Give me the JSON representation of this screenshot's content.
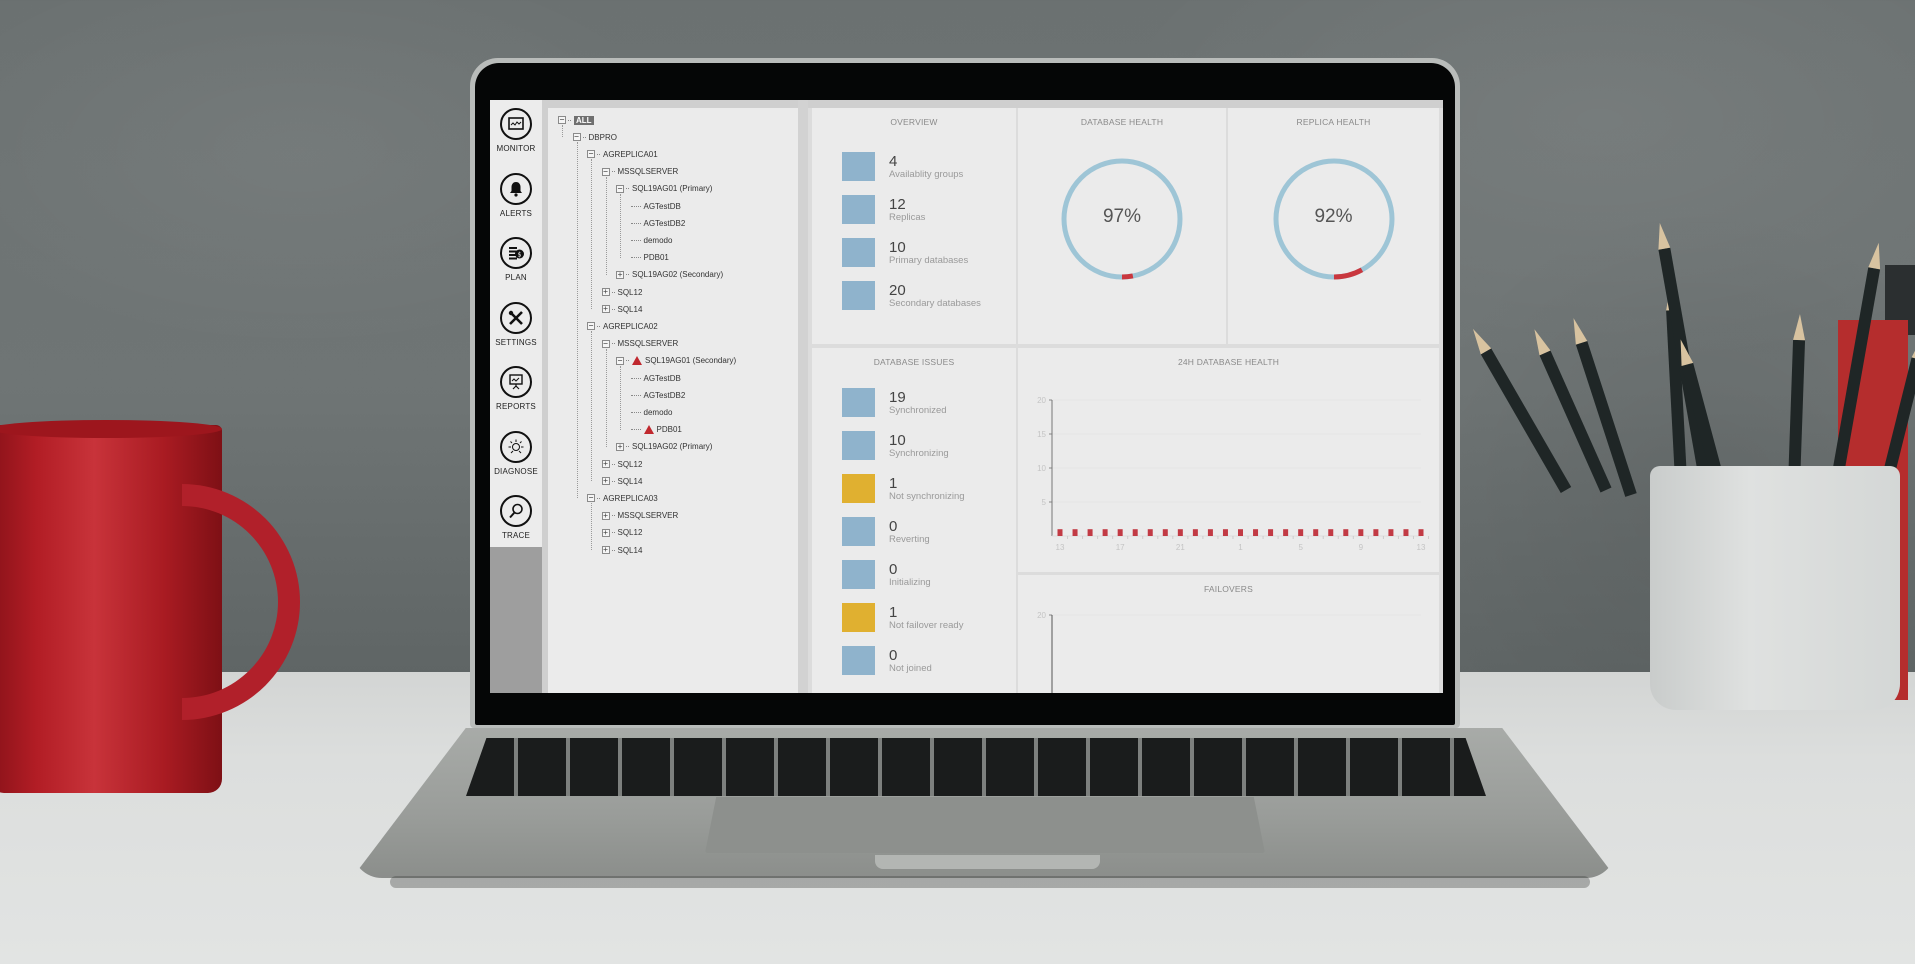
{
  "sidebar": {
    "items": [
      {
        "label": "MONITOR",
        "icon": "monitor-icon"
      },
      {
        "label": "ALERTS",
        "icon": "bell-icon"
      },
      {
        "label": "PLAN",
        "icon": "plan-icon"
      },
      {
        "label": "SETTINGS",
        "icon": "settings-icon"
      },
      {
        "label": "REPORTS",
        "icon": "reports-icon"
      },
      {
        "label": "DIAGNOSE",
        "icon": "lightbulb-icon"
      },
      {
        "label": "TRACE",
        "icon": "magnifier-icon"
      }
    ]
  },
  "tree": {
    "nodes": [
      {
        "label": "ALL",
        "level": 0,
        "expander": "minus",
        "selected": true
      },
      {
        "label": "DBPRO",
        "level": 1,
        "expander": "minus"
      },
      {
        "label": "AGREPLICA01",
        "level": 2,
        "expander": "minus"
      },
      {
        "label": "MSSQLSERVER",
        "level": 3,
        "expander": "minus"
      },
      {
        "label": "SQL19AG01 (Primary)",
        "level": 4,
        "expander": "minus"
      },
      {
        "label": "AGTestDB",
        "level": 5,
        "expander": "leaf"
      },
      {
        "label": "AGTestDB2",
        "level": 5,
        "expander": "leaf"
      },
      {
        "label": "demodo",
        "level": 5,
        "expander": "leaf"
      },
      {
        "label": "PDB01",
        "level": 5,
        "expander": "leaf"
      },
      {
        "label": "SQL19AG02 (Secondary)",
        "level": 4,
        "expander": "plus"
      },
      {
        "label": "SQL12",
        "level": 3,
        "expander": "plus"
      },
      {
        "label": "SQL14",
        "level": 3,
        "expander": "plus"
      },
      {
        "label": "AGREPLICA02",
        "level": 2,
        "expander": "minus"
      },
      {
        "label": "MSSQLSERVER",
        "level": 3,
        "expander": "minus"
      },
      {
        "label": "SQL19AG01 (Secondary)",
        "level": 4,
        "expander": "minus",
        "warning": true
      },
      {
        "label": "AGTestDB",
        "level": 5,
        "expander": "leaf"
      },
      {
        "label": "AGTestDB2",
        "level": 5,
        "expander": "leaf"
      },
      {
        "label": "demodo",
        "level": 5,
        "expander": "leaf"
      },
      {
        "label": "PDB01",
        "level": 5,
        "expander": "leaf",
        "warning": true
      },
      {
        "label": "SQL19AG02 (Primary)",
        "level": 4,
        "expander": "plus"
      },
      {
        "label": "SQL12",
        "level": 3,
        "expander": "plus"
      },
      {
        "label": "SQL14",
        "level": 3,
        "expander": "plus"
      },
      {
        "label": "AGREPLICA03",
        "level": 2,
        "expander": "minus"
      },
      {
        "label": "MSSQLSERVER",
        "level": 3,
        "expander": "plus"
      },
      {
        "label": "SQL12",
        "level": 3,
        "expander": "plus"
      },
      {
        "label": "SQL14",
        "level": 3,
        "expander": "plus"
      }
    ]
  },
  "overview": {
    "title": "OVERVIEW",
    "stats": [
      {
        "value": "4",
        "label": "Availablity groups",
        "status": "ok"
      },
      {
        "value": "12",
        "label": "Replicas",
        "status": "ok"
      },
      {
        "value": "10",
        "label": "Primary databases",
        "status": "ok"
      },
      {
        "value": "20",
        "label": "Secondary databases",
        "status": "ok"
      }
    ]
  },
  "database_health": {
    "title": "DATABASE HEALTH",
    "value_text": "97%",
    "healthy_fraction": 0.97
  },
  "replica_health": {
    "title": "REPLICA HEALTH",
    "value_text": "92%",
    "healthy_fraction": 0.92
  },
  "database_issues": {
    "title": "DATABASE ISSUES",
    "stats": [
      {
        "value": "19",
        "label": "Synchronized",
        "status": "ok"
      },
      {
        "value": "10",
        "label": "Synchronizing",
        "status": "ok"
      },
      {
        "value": "1",
        "label": "Not synchronizing",
        "status": "warning"
      },
      {
        "value": "0",
        "label": "Reverting",
        "status": "ok"
      },
      {
        "value": "0",
        "label": "Initializing",
        "status": "ok"
      },
      {
        "value": "1",
        "label": "Not failover ready",
        "status": "warning"
      },
      {
        "value": "0",
        "label": "Not joined",
        "status": "ok"
      }
    ]
  },
  "colors": {
    "ok": "#8fb3cc",
    "warning": "#e0b030",
    "ring": "#9ec5d6",
    "error": "#c9373e"
  },
  "chart_data": [
    {
      "type": "bar",
      "title": "24H DATABASE HEALTH",
      "xlabel": "",
      "ylabel": "",
      "ylim": [
        0,
        20
      ],
      "yticks": [
        "20",
        "15",
        "10",
        "5"
      ],
      "xticks": [
        "13",
        "17",
        "21",
        "1",
        "5",
        "9",
        "13"
      ],
      "categories": [
        "13",
        "14",
        "15",
        "16",
        "17",
        "18",
        "19",
        "20",
        "21",
        "22",
        "23",
        "0",
        "1",
        "2",
        "3",
        "4",
        "5",
        "6",
        "7",
        "8",
        "9",
        "10",
        "11",
        "12",
        "13"
      ],
      "values": [
        1,
        1,
        1,
        1,
        1,
        1,
        1,
        1,
        1,
        1,
        1,
        1,
        1,
        1,
        1,
        1,
        1,
        1,
        1,
        1,
        1,
        1,
        1,
        1,
        1
      ],
      "grid": true
    },
    {
      "type": "bar",
      "title": "FAILOVERS",
      "ylim": [
        0,
        20
      ],
      "yticks": [
        "20"
      ],
      "categories": [],
      "values": []
    }
  ]
}
